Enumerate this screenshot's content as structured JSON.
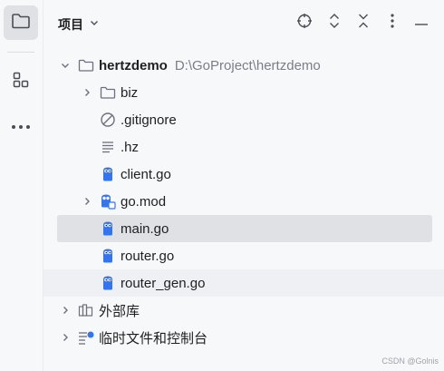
{
  "header": {
    "title": "项目"
  },
  "tree": {
    "root": {
      "name": "hertzdemo",
      "path": "D:\\GoProject\\hertzdemo"
    },
    "items": [
      {
        "label": "biz"
      },
      {
        "label": ".gitignore"
      },
      {
        "label": ".hz"
      },
      {
        "label": "client.go"
      },
      {
        "label": "go.mod"
      },
      {
        "label": "main.go"
      },
      {
        "label": "router.go"
      },
      {
        "label": "router_gen.go"
      }
    ],
    "external_libraries": "外部库",
    "scratches": "临时文件和控制台"
  },
  "watermark": "CSDN @Golnis",
  "colors": {
    "selected_bg": "#dfe1e5",
    "hover_bg": "#eef0f3",
    "go_icon": "#3574f0",
    "hint_text": "#7a7e85"
  },
  "icons": {
    "strip": [
      "folder-icon",
      "structure-icon",
      "more-icon"
    ],
    "header": [
      "locate-icon",
      "expand-all-icon",
      "collapse-all-icon",
      "options-icon",
      "hide-icon"
    ]
  }
}
